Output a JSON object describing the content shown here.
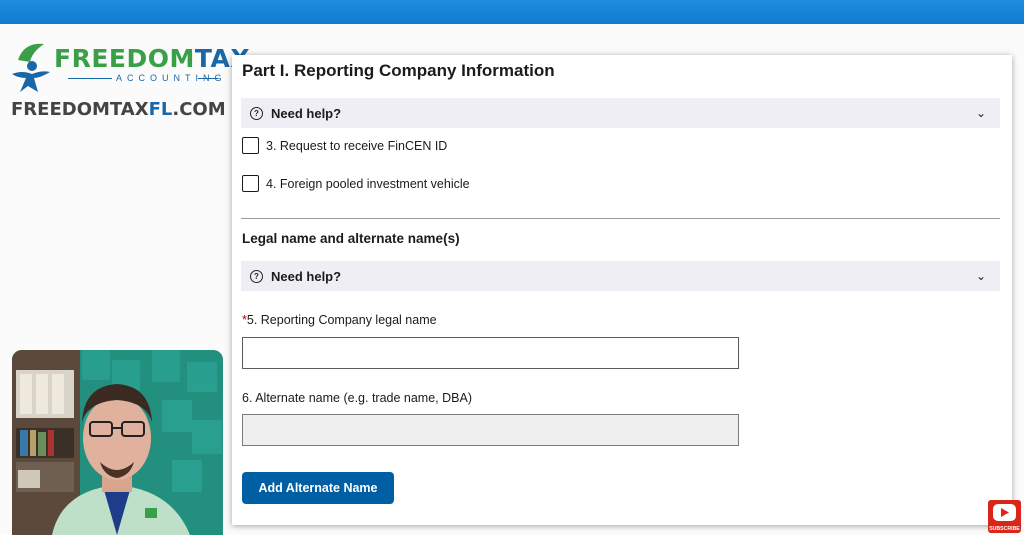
{
  "branding": {
    "logo_part1": "FREEDOM",
    "logo_part2": "TAX",
    "logo_sub": "ACCOUNTING",
    "url_part1": "FREEDOMTAX",
    "url_part2": "FL",
    "url_part3": ".COM"
  },
  "form": {
    "part_title": "Part I. Reporting Company Information",
    "help_label": "Need help?",
    "checkbox_3": "3. Request to receive FinCEN ID",
    "checkbox_4": "4. Foreign pooled investment vehicle",
    "section_title": "Legal name and alternate name(s)",
    "required_mark": "*",
    "field_5_label": "5. Reporting Company legal name",
    "field_5_value": "",
    "field_6_label": "6. Alternate name (e.g. trade name, DBA)",
    "field_6_value": "",
    "add_alternate_button": "Add Alternate Name"
  },
  "overlay": {
    "subscribe_label": "SUBSCRIBE"
  },
  "colors": {
    "top_bar": "#1380d6",
    "button": "#005ea2",
    "help_bar": "#efeef4",
    "brand_green": "#3aa047",
    "brand_blue": "#1a67a8",
    "required": "#b50909"
  },
  "icons": [
    "question-circle-icon",
    "chevron-down-icon",
    "youtube-play-icon"
  ]
}
